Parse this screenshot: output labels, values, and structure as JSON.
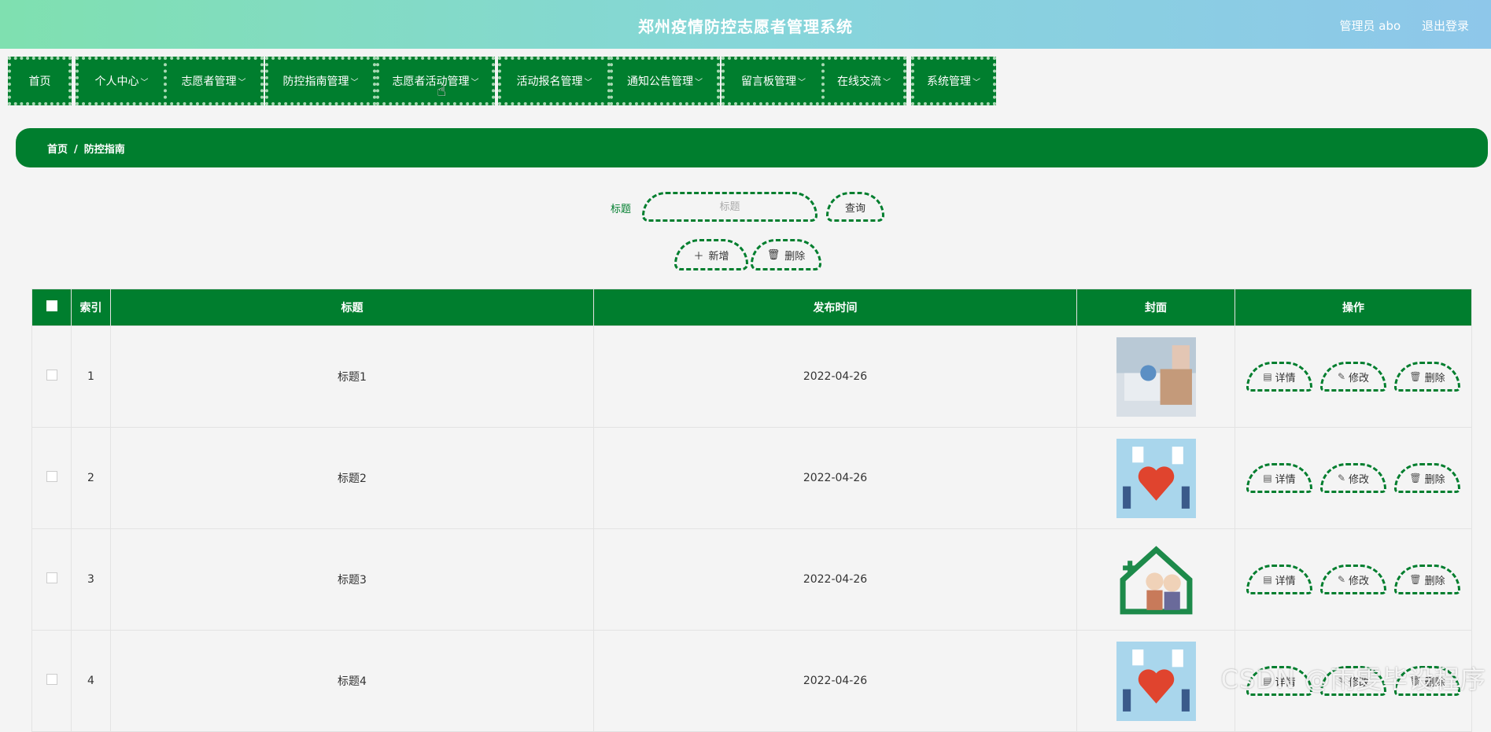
{
  "header": {
    "title": "郑州疫情防控志愿者管理系统",
    "user_label": "管理员 abo",
    "logout_label": "退出登录"
  },
  "nav": [
    {
      "label": "首页",
      "has_dropdown": false
    },
    {
      "label": "个人中心",
      "has_dropdown": true
    },
    {
      "label": "志愿者管理",
      "has_dropdown": true
    },
    {
      "label": "防控指南管理",
      "has_dropdown": true
    },
    {
      "label": "志愿者活动管理",
      "has_dropdown": true
    },
    {
      "label": "活动报名管理",
      "has_dropdown": true
    },
    {
      "label": "通知公告管理",
      "has_dropdown": true
    },
    {
      "label": "留言板管理",
      "has_dropdown": true
    },
    {
      "label": "在线交流",
      "has_dropdown": true
    },
    {
      "label": "系统管理",
      "has_dropdown": true
    }
  ],
  "breadcrumb": {
    "home": "首页",
    "separator": "/",
    "current": "防控指南"
  },
  "search": {
    "label": "标题",
    "placeholder": "标题",
    "query_button": "查询"
  },
  "actions": {
    "add_label": "新增",
    "delete_label": "删除"
  },
  "table": {
    "headers": {
      "index": "索引",
      "title": "标题",
      "publish_time": "发布时间",
      "cover": "封面",
      "actions": "操作"
    },
    "rows": [
      {
        "index": "1",
        "title": "标题1",
        "publish_time": "2022-04-26",
        "cover": "medical-scene"
      },
      {
        "index": "2",
        "title": "标题2",
        "publish_time": "2022-04-26",
        "cover": "heart-volunteers"
      },
      {
        "index": "3",
        "title": "标题3",
        "publish_time": "2022-04-26",
        "cover": "elderly-care-house"
      },
      {
        "index": "4",
        "title": "标题4",
        "publish_time": "2022-04-26",
        "cover": "heart-volunteers"
      }
    ],
    "row_buttons": {
      "detail": "详情",
      "edit": "修改",
      "delete": "删除"
    }
  },
  "watermark": "CSDN @雨雯毕设程序",
  "colors": {
    "primary": "#007e2e",
    "header_start": "#7fe0b0",
    "header_end": "#8ec7ea"
  }
}
